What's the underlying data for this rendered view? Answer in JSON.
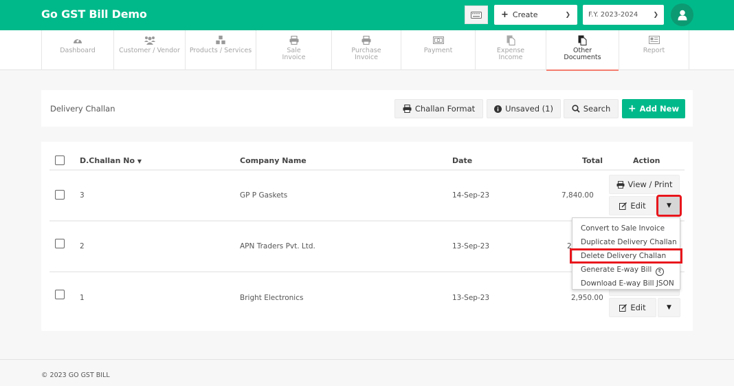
{
  "app": {
    "title": "Go GST Bill Demo"
  },
  "topbar": {
    "keyboard_icon": "keyboard-icon",
    "create": {
      "label": "Create",
      "icon": "plus-icon"
    },
    "fiscal_year": {
      "selected": "F.Y. 2023-2024"
    },
    "user_icon": "user-icon"
  },
  "nav": {
    "items": [
      {
        "label": "Dashboard",
        "icon": "dashboard-icon",
        "active": false
      },
      {
        "label": "Customer / Vendor",
        "icon": "users-icon",
        "active": false
      },
      {
        "label": "Products / Services",
        "icon": "cubes-icon",
        "active": false
      },
      {
        "label": "Sale\nInvoice",
        "line1": "Sale",
        "line2": "Invoice",
        "icon": "printer-icon",
        "active": false
      },
      {
        "label": "Purchase\nInvoice",
        "line1": "Purchase",
        "line2": "Invoice",
        "icon": "printer-icon",
        "active": false
      },
      {
        "label": "Payment",
        "icon": "money-icon",
        "active": false
      },
      {
        "label": "Expense\nIncome",
        "line1": "Expense",
        "line2": "Income",
        "icon": "documents-icon",
        "active": false
      },
      {
        "label": "Other\nDocuments",
        "line1": "Other",
        "line2": "Documents",
        "icon": "documents-icon",
        "active": true
      },
      {
        "label": "Report",
        "icon": "report-icon",
        "active": false
      }
    ]
  },
  "page": {
    "title": "Delivery Challan",
    "buttons": {
      "challan_format": "Challan Format",
      "unsaved": "Unsaved (1)",
      "search": "Search",
      "add_new": "Add New"
    }
  },
  "table": {
    "columns": {
      "challan_no": "D.Challan No",
      "company": "Company Name",
      "date": "Date",
      "total": "Total",
      "action": "Action"
    },
    "rows": [
      {
        "challan_no": "3",
        "company": "GP P Gaskets",
        "date": "14-Sep-23",
        "total": "7,840.00"
      },
      {
        "challan_no": "2",
        "company": "APN Traders Pvt. Ltd.",
        "date": "13-Sep-23",
        "total": "2"
      },
      {
        "challan_no": "1",
        "company": "Bright Electronics",
        "date": "13-Sep-23",
        "total": "2,950.00"
      }
    ],
    "action_labels": {
      "view_print": "View / Print",
      "edit": "Edit"
    }
  },
  "dropdown": {
    "items": [
      {
        "label": "Convert to Sale Invoice"
      },
      {
        "label": "Duplicate Delivery Challan"
      },
      {
        "label": "Delete Delivery Challan",
        "highlighted": true
      },
      {
        "label": "Generate E-way Bill",
        "suffix_icon": "rupee-icon"
      },
      {
        "label": "Download E-way Bill JSON"
      }
    ]
  },
  "highlight_color": "#e8161c",
  "brand_color": "#00b98a",
  "footer": {
    "text": "© 2023 GO GST BILL"
  }
}
